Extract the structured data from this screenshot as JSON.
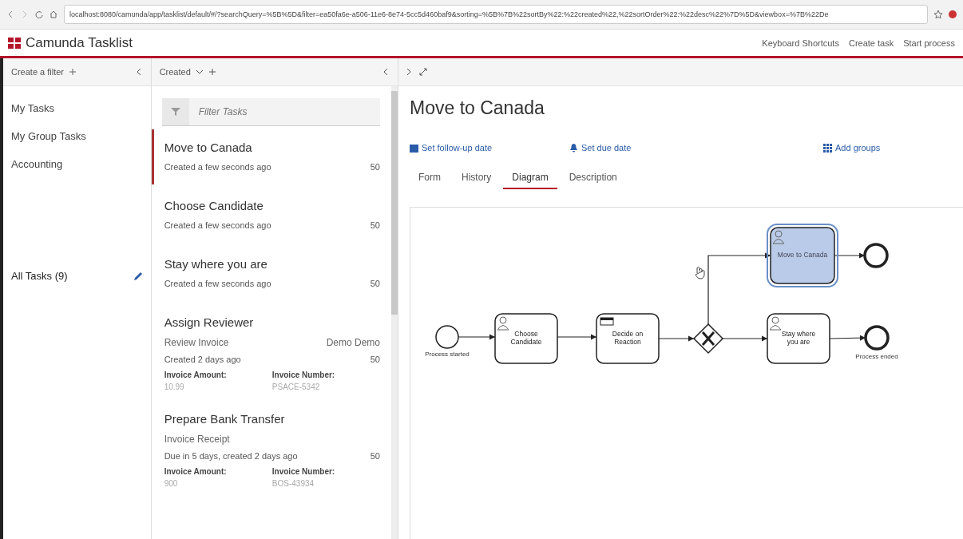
{
  "browser": {
    "url": "localhost:8080/camunda/app/tasklist/default/#/?searchQuery=%5B%5D&filter=ea50fa6e-a506-11e6-8e74-5cc5d460baf9&sorting=%5B%7B%22sortBy%22:%22created%22,%22sortOrder%22:%22desc%22%7D%5D&viewbox=%7B%22De"
  },
  "header": {
    "title": "Camunda Tasklist",
    "actions": [
      "Keyboard Shortcuts",
      "Create task",
      "Start process"
    ]
  },
  "sidebar": {
    "create_filter": "Create a filter",
    "items": [
      {
        "label": "My Tasks"
      },
      {
        "label": "My Group Tasks"
      },
      {
        "label": "Accounting"
      },
      {
        "label": "All Tasks (9)"
      }
    ]
  },
  "task_list": {
    "sort": "Created",
    "filter_placeholder": "Filter Tasks",
    "tasks": [
      {
        "name": "Move to Canada",
        "selected": true,
        "created": "Created a few seconds ago",
        "priority": "50"
      },
      {
        "name": "Choose Candidate",
        "selected": false,
        "created": "Created a few seconds ago",
        "priority": "50"
      },
      {
        "name": "Stay where you are",
        "selected": false,
        "created": "Created a few seconds ago",
        "priority": "50"
      },
      {
        "name": "Assign Reviewer",
        "selected": false,
        "process": "Review Invoice",
        "assignee": "Demo Demo",
        "created": "Created 2 days ago",
        "priority": "50",
        "variables": [
          {
            "label": "Invoice Amount:",
            "value": "10.99"
          },
          {
            "label": "Invoice Number:",
            "value": "PSACE-5342"
          }
        ]
      },
      {
        "name": "Prepare Bank Transfer",
        "selected": false,
        "process": "Invoice Receipt",
        "created": "Due in 5 days, created 2 days ago",
        "priority": "50",
        "variables": [
          {
            "label": "Invoice Amount:",
            "value": "900"
          },
          {
            "label": "Invoice Number:",
            "value": "BOS-43934"
          }
        ]
      }
    ]
  },
  "detail": {
    "title": "Move to Canada",
    "actions": [
      {
        "kind": "follow_up",
        "label": "Set follow-up date"
      },
      {
        "kind": "due",
        "label": "Set due date"
      },
      {
        "kind": "groups",
        "label": "Add groups"
      }
    ],
    "tabs": [
      {
        "label": "Form",
        "selected": false
      },
      {
        "label": "History",
        "selected": false
      },
      {
        "label": "Diagram",
        "selected": true
      },
      {
        "label": "Description",
        "selected": false
      }
    ],
    "diagram": {
      "nodes": [
        {
          "kind": "start",
          "label": "Process started"
        },
        {
          "kind": "user_task",
          "label": "Choose Candidate",
          "selected": false
        },
        {
          "kind": "rule_task",
          "label": "Decide on Reaction",
          "selected": false
        },
        {
          "kind": "gateway"
        },
        {
          "kind": "user_task",
          "label": "Stay where you are",
          "selected": false
        },
        {
          "kind": "end",
          "label": "Process ended"
        },
        {
          "kind": "user_task",
          "label": "Move to Canada",
          "selected": true
        },
        {
          "kind": "end"
        }
      ]
    }
  }
}
